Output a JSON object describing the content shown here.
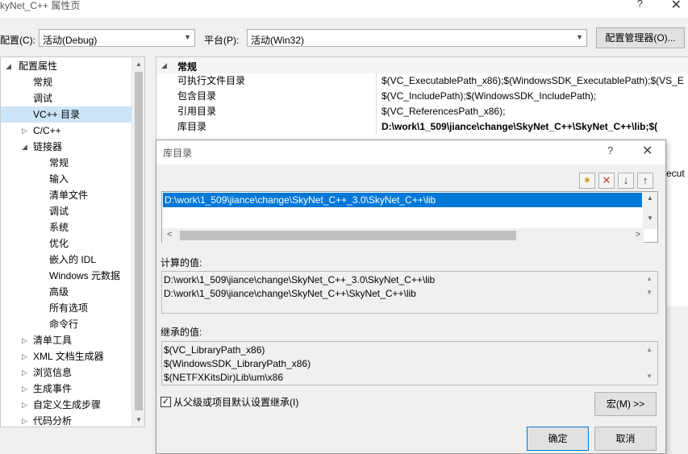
{
  "window": {
    "title": "kyNet_C++ 属性页",
    "help": "?",
    "close": "✕"
  },
  "config": {
    "config_label": "配置(C):",
    "config_value": "活动(Debug)",
    "platform_label": "平台(P):",
    "platform_value": "活动(Win32)",
    "manager_button": "配置管理器(O)..."
  },
  "tree": {
    "items": [
      {
        "label": "配置属性",
        "expander": "◢"
      },
      {
        "label": "常规"
      },
      {
        "label": "调试"
      },
      {
        "label": "VC++ 目录"
      },
      {
        "label": "C/C++",
        "expander": "▷"
      },
      {
        "label": "链接器",
        "expander": "◢"
      },
      {
        "label": "常规"
      },
      {
        "label": "输入"
      },
      {
        "label": "清单文件"
      },
      {
        "label": "调试"
      },
      {
        "label": "系统"
      },
      {
        "label": "优化"
      },
      {
        "label": "嵌入的 IDL"
      },
      {
        "label": "Windows 元数据"
      },
      {
        "label": "高级"
      },
      {
        "label": "所有选项"
      },
      {
        "label": "命令行"
      },
      {
        "label": "清单工具",
        "expander": "▷"
      },
      {
        "label": "XML 文档生成器",
        "expander": "▷"
      },
      {
        "label": "浏览信息",
        "expander": "▷"
      },
      {
        "label": "生成事件",
        "expander": "▷"
      },
      {
        "label": "自定义生成步骤",
        "expander": "▷"
      },
      {
        "label": "代码分析",
        "expander": "▷"
      }
    ]
  },
  "grid": {
    "category": "常规",
    "category_expander": "◢",
    "rows": [
      {
        "name": "可执行文件目录",
        "value": "$(VC_ExecutablePath_x86);$(WindowsSDK_ExecutablePath);$(VS_E"
      },
      {
        "name": "包含目录",
        "value": "$(VC_IncludePath);$(WindowsSDK_IncludePath);"
      },
      {
        "name": "引用目录",
        "value": "$(VC_ReferencesPath_x86);"
      },
      {
        "name": "库目录",
        "value": "D:\\work\\1_509\\jiance\\change\\SkyNet_C++\\SkyNet_C++\\lib;$("
      }
    ],
    "right_fragment": "ecut"
  },
  "dialog": {
    "title": "库目录",
    "help": "?",
    "close": "✕",
    "toolbar": {
      "new_icon": "✶",
      "delete_icon": "✕",
      "down_icon": "↓",
      "up_icon": "↑"
    },
    "list_items": [
      "D:\\work\\1_509\\jiance\\change\\SkyNet_C++_3.0\\SkyNet_C++\\lib"
    ],
    "evaluated_label": "计算的值:",
    "evaluated_lines": [
      "D:\\work\\1_509\\jiance\\change\\SkyNet_C++_3.0\\SkyNet_C++\\lib",
      "D:\\work\\1_509\\jiance\\change\\SkyNet_C++\\SkyNet_C++\\lib"
    ],
    "inherited_label": "继承的值:",
    "inherited_lines": [
      "$(VC_LibraryPath_x86)",
      "$(WindowsSDK_LibraryPath_x86)",
      "$(NETFXKitsDir)Lib\\um\\x86"
    ],
    "inherit_checkbox_label": "从父级或项目默认设置继承(I)",
    "inherit_checked": true,
    "macro_button": "宏(M) >>",
    "ok_button": "确定",
    "cancel_button": "取消"
  }
}
